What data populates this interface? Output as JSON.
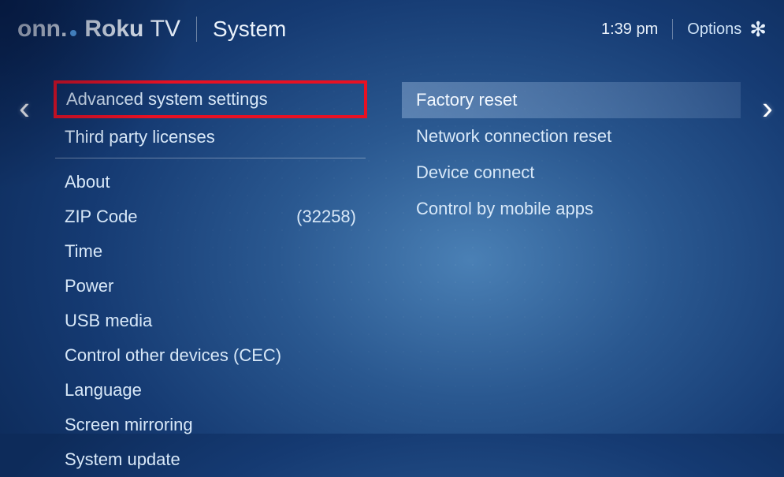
{
  "header": {
    "brand_onn": "onn",
    "brand_roku": "Roku",
    "brand_tv": "TV",
    "page_title": "System",
    "time": "1:39 pm",
    "options_label": "Options"
  },
  "left": {
    "advanced": "Advanced system settings",
    "licenses": "Third party licenses",
    "about": "About",
    "zip_label": "ZIP Code",
    "zip_value": "(32258)",
    "time": "Time",
    "power": "Power",
    "usb": "USB media",
    "cec": "Control other devices (CEC)",
    "language": "Language",
    "mirroring": "Screen mirroring",
    "update": "System update"
  },
  "right": {
    "factory_reset": "Factory reset",
    "network_reset": "Network connection reset",
    "device_connect": "Device connect",
    "mobile_apps": "Control by mobile apps"
  }
}
